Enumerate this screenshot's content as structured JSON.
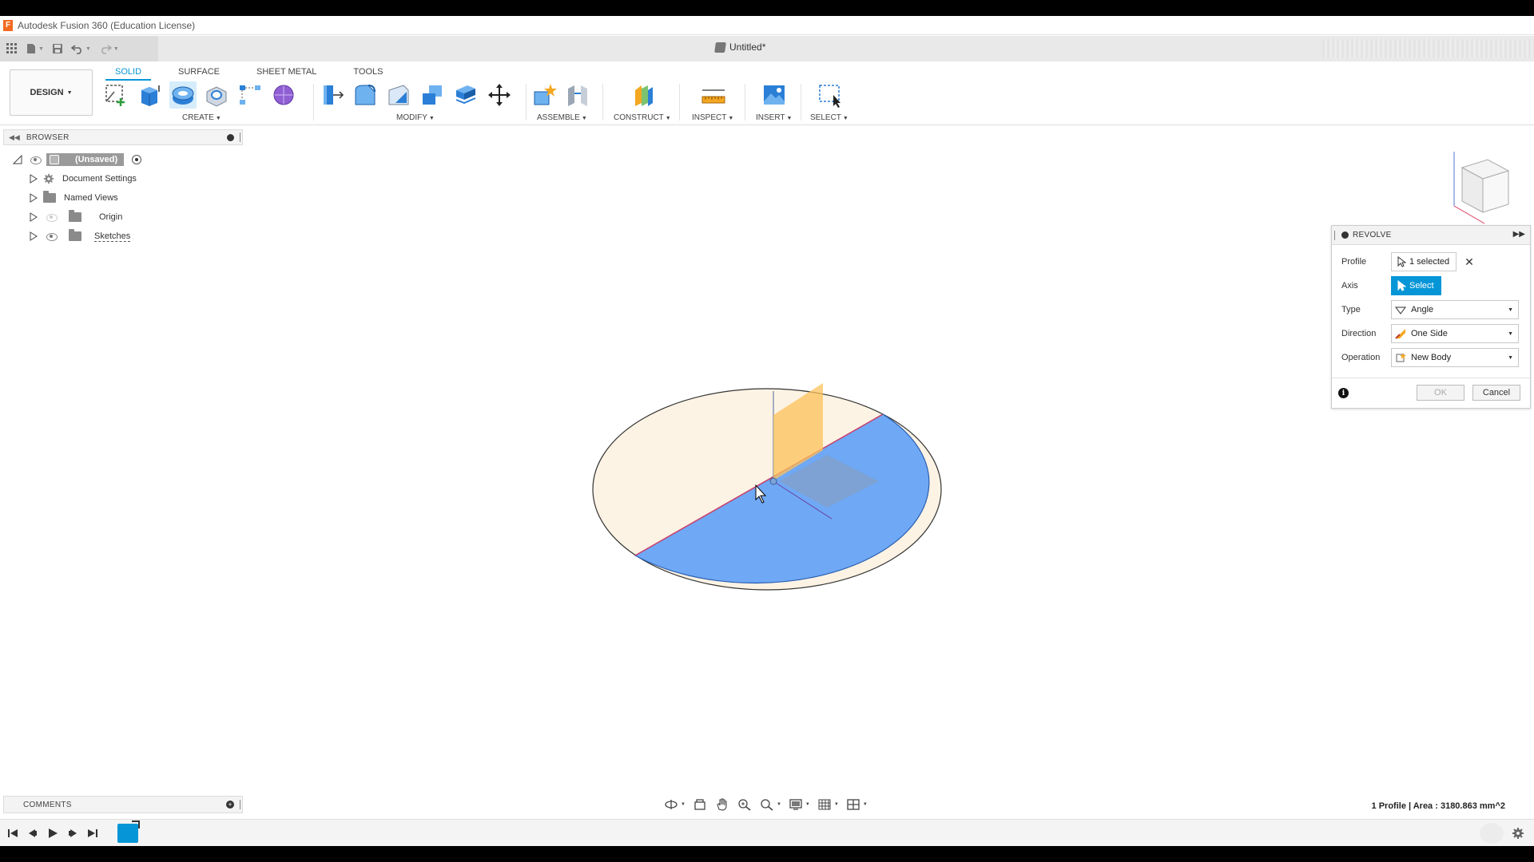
{
  "window": {
    "title": "Autodesk Fusion 360 (Education License)",
    "logo_letter": "F"
  },
  "document": {
    "tab_title": "Untitled*"
  },
  "workspace": {
    "label": "DESIGN"
  },
  "ribbon": {
    "tabs": [
      "SOLID",
      "SURFACE",
      "SHEET METAL",
      "TOOLS"
    ],
    "active_tab": "SOLID",
    "groups": {
      "create": "CREATE",
      "modify": "MODIFY",
      "assemble": "ASSEMBLE",
      "construct": "CONSTRUCT",
      "inspect": "INSPECT",
      "insert": "INSERT",
      "select": "SELECT"
    }
  },
  "browser": {
    "title": "BROWSER",
    "root": "(Unsaved)",
    "items": [
      "Document Settings",
      "Named Views",
      "Origin",
      "Sketches"
    ]
  },
  "revolve_dialog": {
    "title": "REVOLVE",
    "rows": {
      "profile": {
        "label": "Profile",
        "value": "1 selected"
      },
      "axis": {
        "label": "Axis",
        "value": "Select"
      },
      "type": {
        "label": "Type",
        "value": "Angle"
      },
      "direction": {
        "label": "Direction",
        "value": "One Side"
      },
      "operation": {
        "label": "Operation",
        "value": "New Body"
      }
    },
    "ok": "OK",
    "cancel": "Cancel"
  },
  "comments": {
    "title": "COMMENTS"
  },
  "status": {
    "text": "1 Profile | Area : 3180.863 mm^2"
  },
  "colors": {
    "accent": "#0696d7",
    "profile_selected": "#6fa8f5",
    "profile_unselected": "#fdf3e4",
    "plane_orange": "#fbc15a"
  }
}
